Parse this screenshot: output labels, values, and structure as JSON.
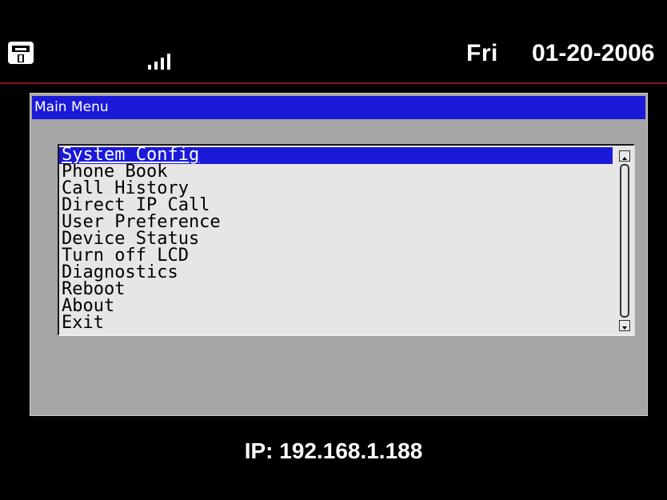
{
  "status_bar": {
    "phone_icon": "phone-icon",
    "signal_icon": "signal-bars-icon",
    "day": "Fri",
    "date": "01-20-2006"
  },
  "main_menu": {
    "title": "Main Menu",
    "items": [
      {
        "label": "System Config",
        "selected": true
      },
      {
        "label": "Phone Book",
        "selected": false
      },
      {
        "label": "Call History",
        "selected": false
      },
      {
        "label": "Direct IP Call",
        "selected": false
      },
      {
        "label": "User Preference",
        "selected": false
      },
      {
        "label": "Device Status",
        "selected": false
      },
      {
        "label": "Turn off LCD",
        "selected": false
      },
      {
        "label": "Diagnostics",
        "selected": false
      },
      {
        "label": "Reboot",
        "selected": false
      },
      {
        "label": "About",
        "selected": false
      },
      {
        "label": "Exit",
        "selected": false
      }
    ]
  },
  "footer": {
    "ip": "IP: 192.168.1.188"
  },
  "colors": {
    "background": "#000000",
    "accent_line": "#8a1512",
    "selection": "#1a1ad8",
    "panel": "#a6a6a6",
    "list_bg": "#e6e6e6"
  }
}
